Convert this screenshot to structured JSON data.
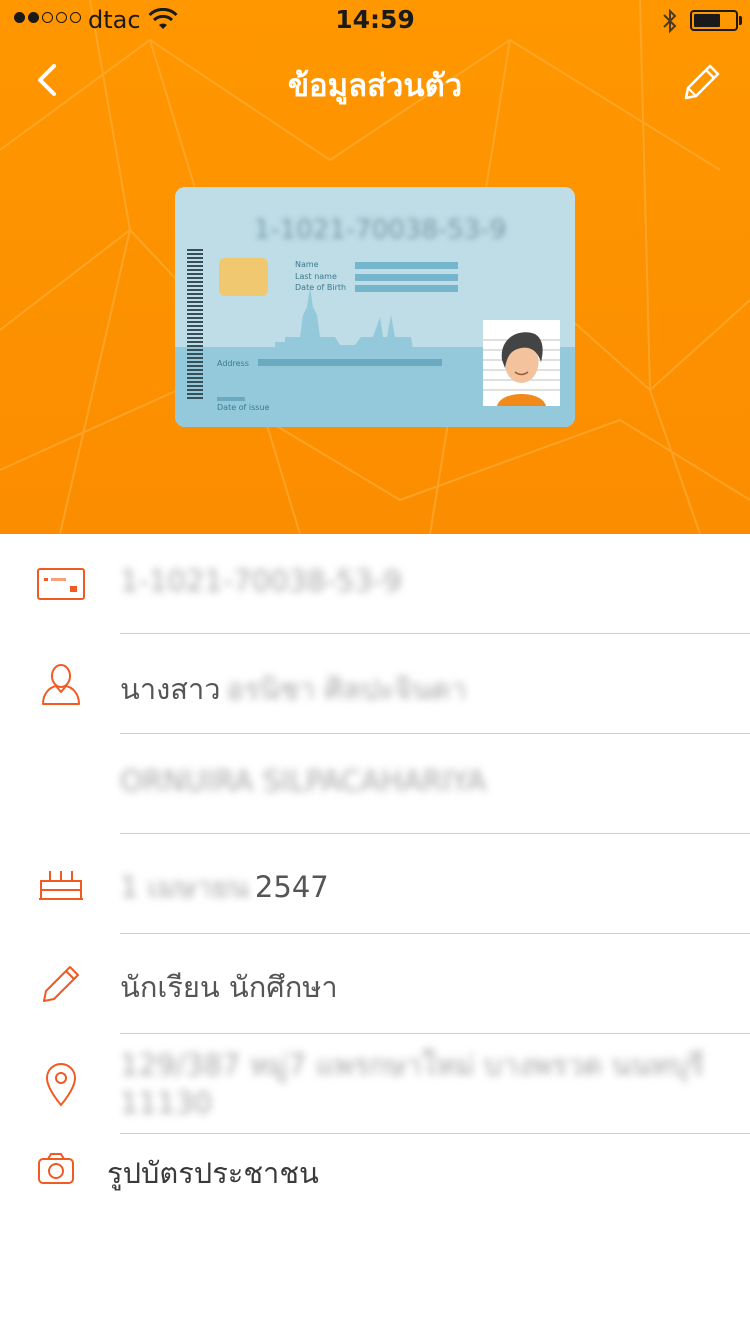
{
  "statusbar": {
    "signal_filled": 2,
    "signal_total": 5,
    "carrier": "dtac",
    "time": "14:59",
    "battery_level": 0.65
  },
  "nav": {
    "title": "ข้อมูลส่วนตัว",
    "back_icon": "chevron-left-icon",
    "edit_icon": "pencil-icon"
  },
  "card": {
    "number": "1-1021-70038-53-9",
    "name_label": "Name",
    "lastname_label": "Last name",
    "dob_label": "Date of Birth",
    "address_label": "Address",
    "issue_label": "Date of issue"
  },
  "info": {
    "id_number": "1-1021-70038-53-9",
    "name_prefix": "นางสาว",
    "name_thai": "อรนิชา ศิลปะจินดา",
    "name_english": "ORNUIRA SILPACAHARIYA",
    "birth_day_month": "1 เมษายน",
    "birth_year": "2547",
    "occupation": "นักเรียน นักศึกษา",
    "address": "129/387 หมู่7 แพรกษาใหม่ บางพรวด นนทบุรี 11130",
    "id_photo_label": "รูปบัตรประชาชน"
  },
  "colors": {
    "header_orange": "#ff9700",
    "icon_orange": "#f15a22",
    "divider": "#cccccc",
    "card_blue": "#bedde6"
  }
}
